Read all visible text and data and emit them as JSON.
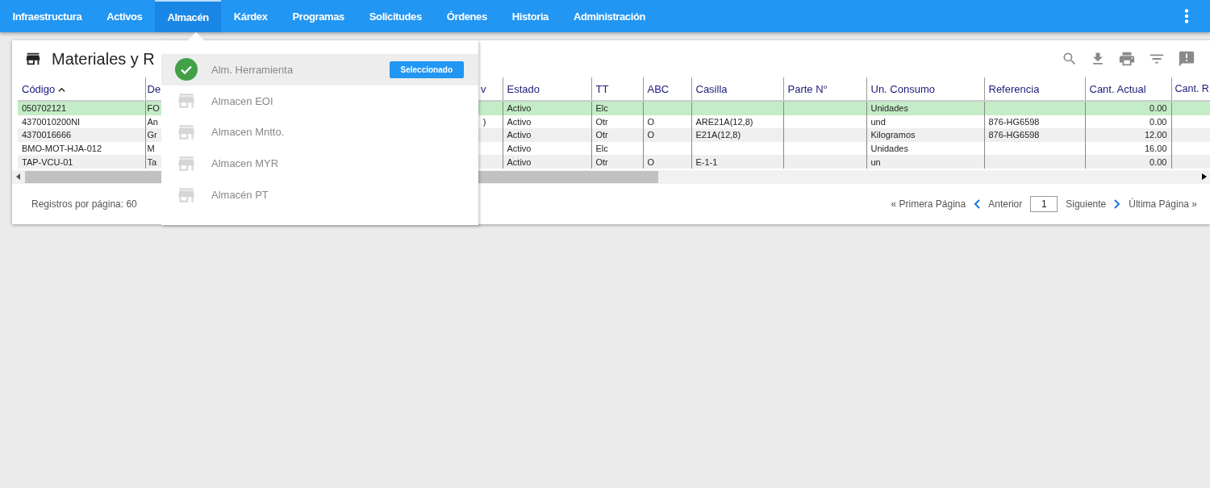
{
  "nav": {
    "items": [
      {
        "label": "Infraestructura",
        "selected": false
      },
      {
        "label": "Activos",
        "selected": false
      },
      {
        "label": "Almacén",
        "selected": true
      },
      {
        "label": "Kárdex",
        "selected": false
      },
      {
        "label": "Programas",
        "selected": false
      },
      {
        "label": "Solicitudes",
        "selected": false
      },
      {
        "label": "Órdenes",
        "selected": false
      },
      {
        "label": "Historia",
        "selected": false
      },
      {
        "label": "Administración",
        "selected": false
      }
    ]
  },
  "panel": {
    "title": "Materiales y R"
  },
  "warehouse_menu": {
    "items": [
      {
        "label": "Alm. Herramienta",
        "selected": true,
        "badge": "Seleccionado"
      },
      {
        "label": "Almacen EOI",
        "selected": false
      },
      {
        "label": "Almacen Mntto.",
        "selected": false
      },
      {
        "label": "Almacen MYR",
        "selected": false
      },
      {
        "label": "Almacén PT",
        "selected": false
      }
    ]
  },
  "table": {
    "columns": [
      {
        "label": "Código",
        "sorted": true
      },
      {
        "label": "De"
      },
      {
        "label": "v"
      },
      {
        "label": "Estado"
      },
      {
        "label": "TT"
      },
      {
        "label": "ABC"
      },
      {
        "label": "Casilla"
      },
      {
        "label": "Parte N°"
      },
      {
        "label": "Un. Consumo"
      },
      {
        "label": "Referencia"
      },
      {
        "label": "Cant. Actual"
      },
      {
        "label": "Cant. R"
      }
    ],
    "rows": [
      {
        "selected": true,
        "cells": [
          "050702121",
          "FO",
          null,
          "Activo",
          "Elc",
          null,
          null,
          null,
          "Unidades",
          null,
          "0.00",
          null
        ]
      },
      {
        "selected": false,
        "cells": [
          "4370010200NI",
          "An",
          ")",
          "Activo",
          "Otr",
          "O",
          "ARE21A(12,8)",
          null,
          "und",
          "876-HG6598",
          "0.00",
          null
        ]
      },
      {
        "selected": false,
        "cells": [
          "4370016666",
          "Gr",
          null,
          "Activo",
          "Otr",
          "O",
          "E21A(12,8)",
          null,
          "Kilogramos",
          "876-HG6598",
          "12.00",
          null
        ]
      },
      {
        "selected": false,
        "cells": [
          "BMO-MOT-HJA-012",
          "M",
          null,
          "Activo",
          "Elc",
          null,
          null,
          null,
          "Unidades",
          null,
          "16.00",
          null
        ]
      },
      {
        "selected": false,
        "cells": [
          "TAP-VCU-01",
          "Ta",
          null,
          "Activo",
          "Otr",
          "O",
          "E-1-1",
          null,
          "un",
          null,
          "0.00",
          null
        ]
      }
    ]
  },
  "footer": {
    "records_per_page": "Registros por página: 60",
    "first": "« Primera Página",
    "previous": "Anterior",
    "page": "1",
    "next": "Siguiente",
    "last": "Última Página »"
  }
}
